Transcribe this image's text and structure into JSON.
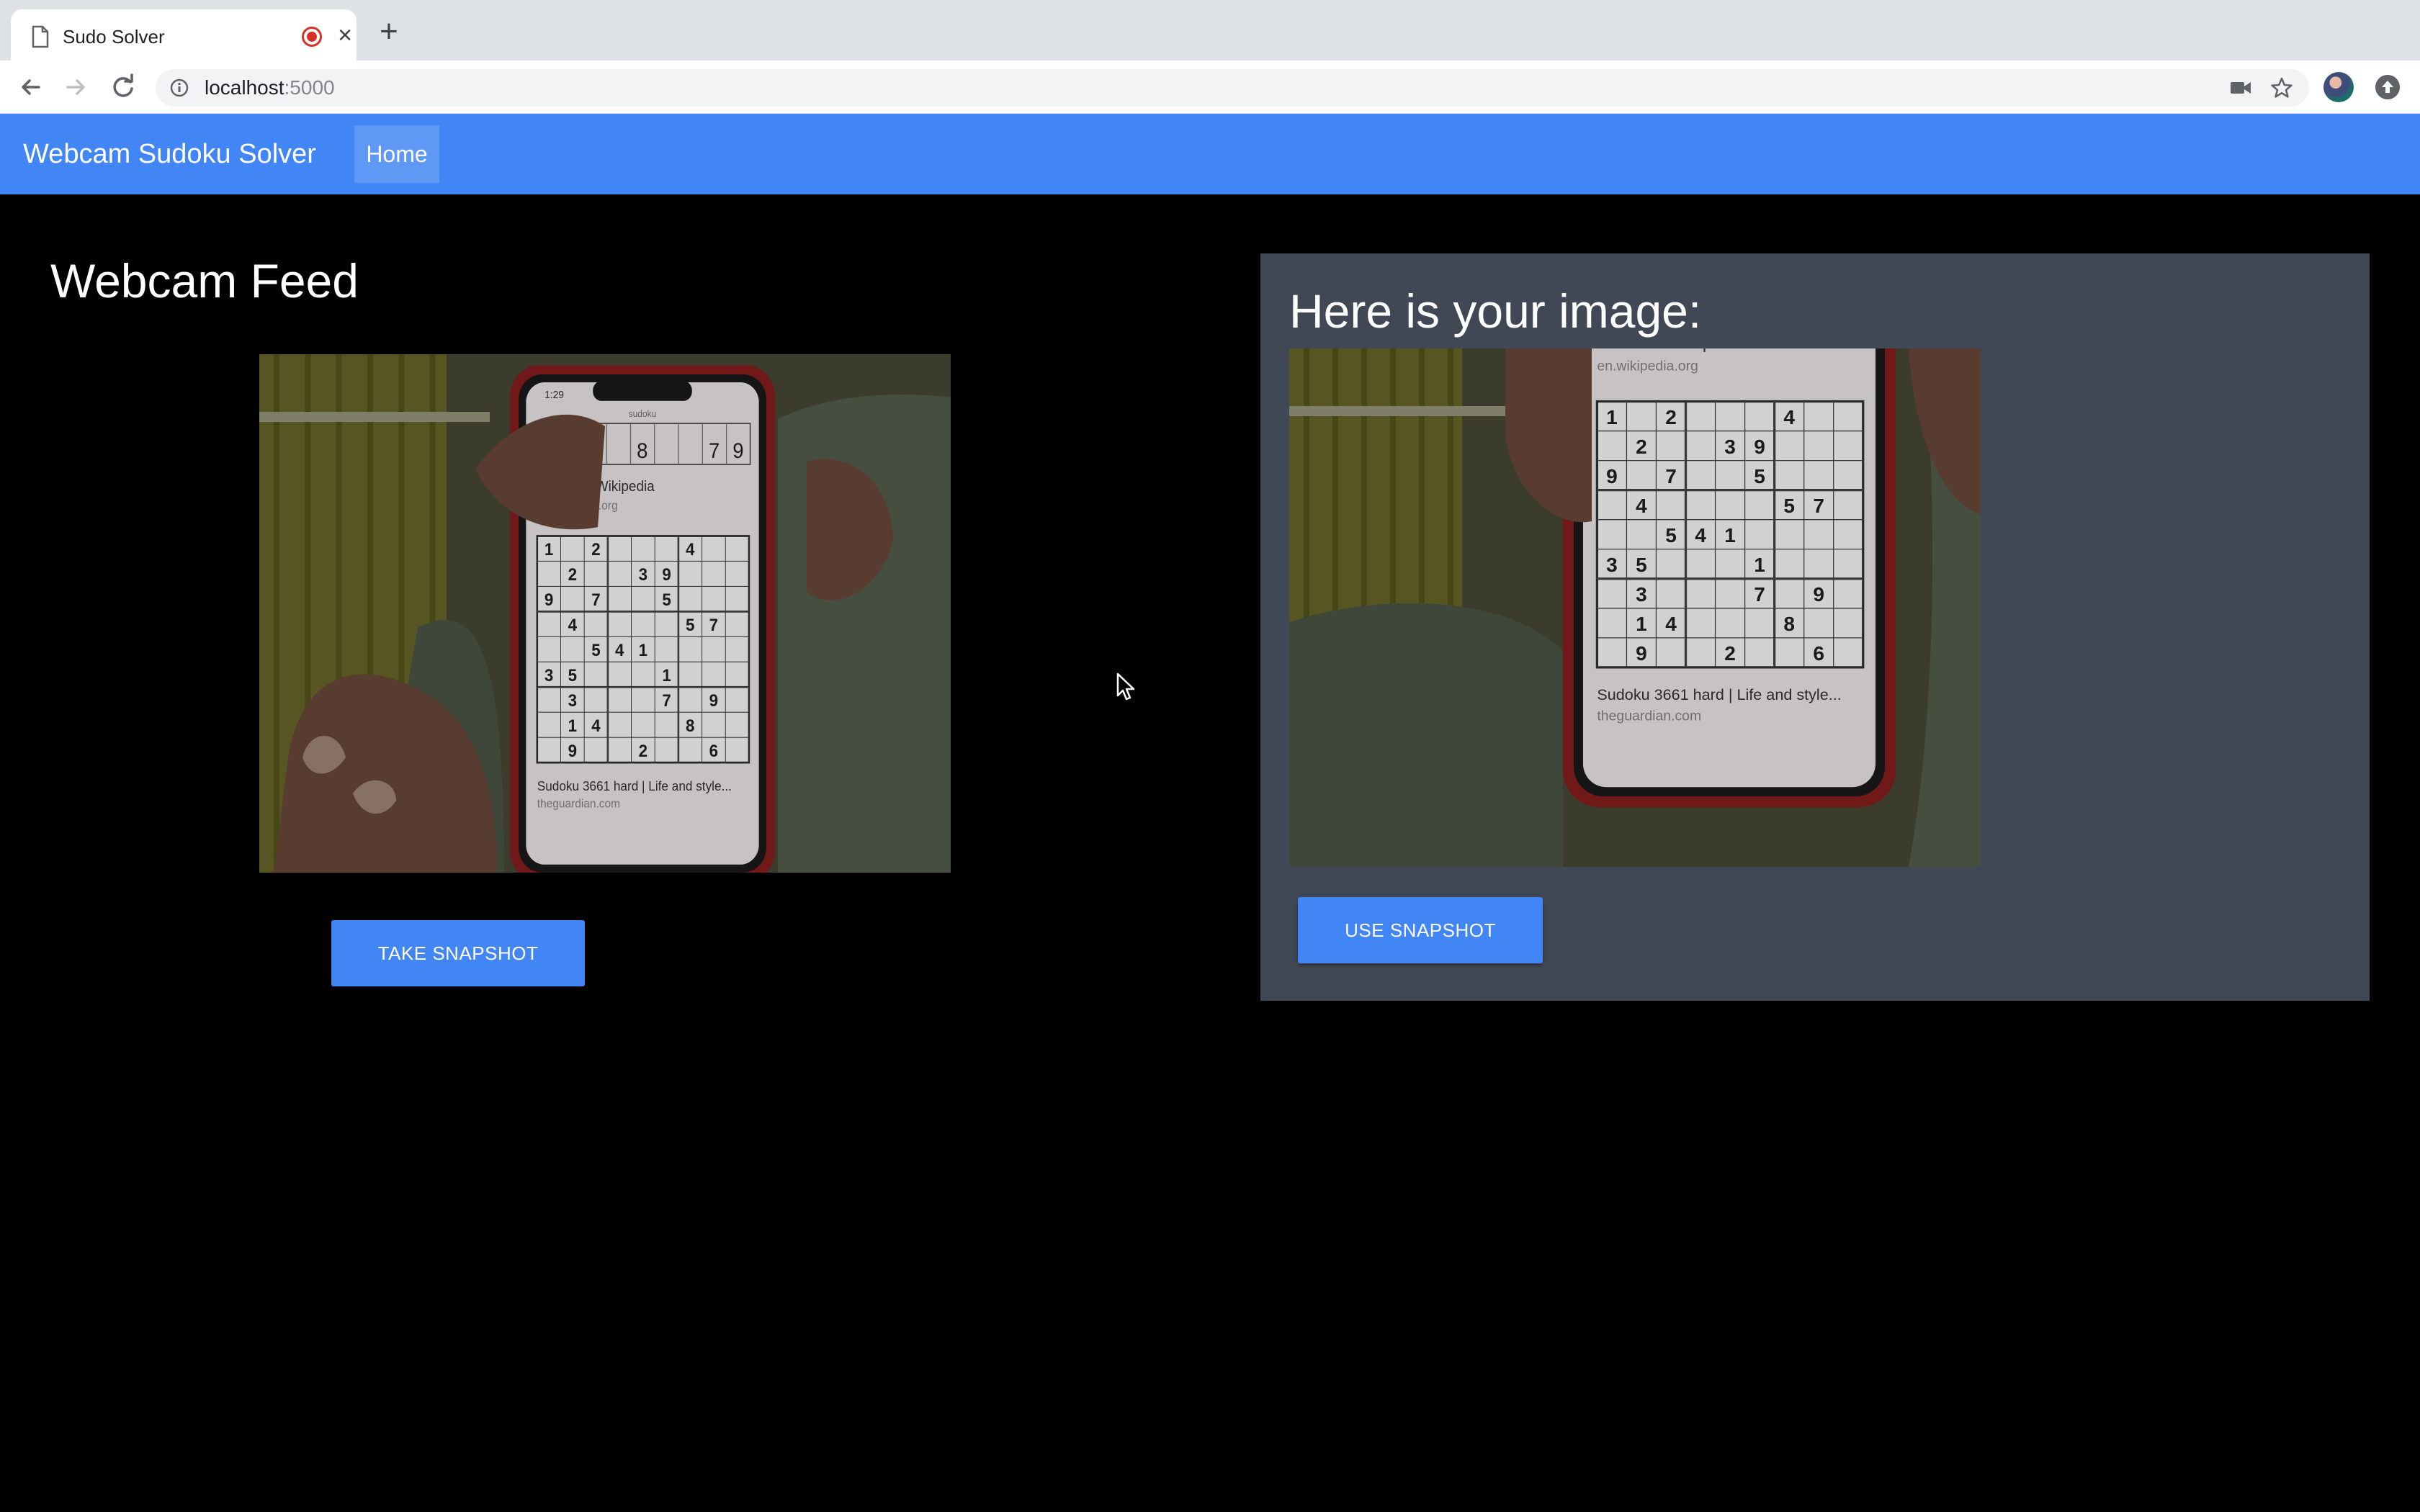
{
  "browser": {
    "tab_title": "Sudo Solver",
    "close_glyph": "×",
    "newtab_glyph": "+",
    "url_host": "localhost",
    "url_port": ":5000"
  },
  "app": {
    "brand": "Webcam Sudoku Solver",
    "nav_home": "Home"
  },
  "feed": {
    "title": "Webcam Feed",
    "button": "TAKE SNAPSHOT"
  },
  "snapshot": {
    "title": "Here is your image:",
    "button": "USE SNAPSHOT"
  },
  "phone_screen": {
    "status_time": "1:29",
    "address": "sudoku",
    "top_row_digits": [
      "8",
      "7",
      "9"
    ],
    "result_title": "Sudoku - Wikipedia",
    "result_url": "en.wikipedia.org",
    "footer_title": "Sudoku 3661 hard | Life and style...",
    "footer_url": "theguardian.com",
    "grid": [
      [
        1,
        0,
        2,
        0,
        0,
        0,
        4,
        0,
        0
      ],
      [
        0,
        2,
        0,
        0,
        3,
        9,
        0,
        0,
        0
      ],
      [
        9,
        0,
        7,
        0,
        0,
        5,
        0,
        0,
        0
      ],
      [
        0,
        4,
        0,
        0,
        0,
        0,
        5,
        7,
        0
      ],
      [
        0,
        0,
        5,
        4,
        1,
        0,
        0,
        0,
        0
      ],
      [
        3,
        5,
        0,
        0,
        0,
        1,
        0,
        0,
        0
      ],
      [
        0,
        3,
        0,
        0,
        0,
        7,
        0,
        9,
        0
      ],
      [
        0,
        1,
        4,
        0,
        0,
        0,
        8,
        0,
        0
      ],
      [
        0,
        9,
        0,
        0,
        2,
        0,
        0,
        6,
        0
      ]
    ]
  },
  "colors": {
    "accent": "#4285f4",
    "panel": "#414855",
    "page_bg": "#000000"
  },
  "icons": [
    "page-icon",
    "recording-icon",
    "close-icon",
    "plus-icon",
    "back-arrow-icon",
    "forward-arrow-icon",
    "reload-icon",
    "info-icon",
    "camera-icon",
    "star-icon",
    "profile-avatar",
    "update-icon",
    "mouse-cursor-icon"
  ]
}
